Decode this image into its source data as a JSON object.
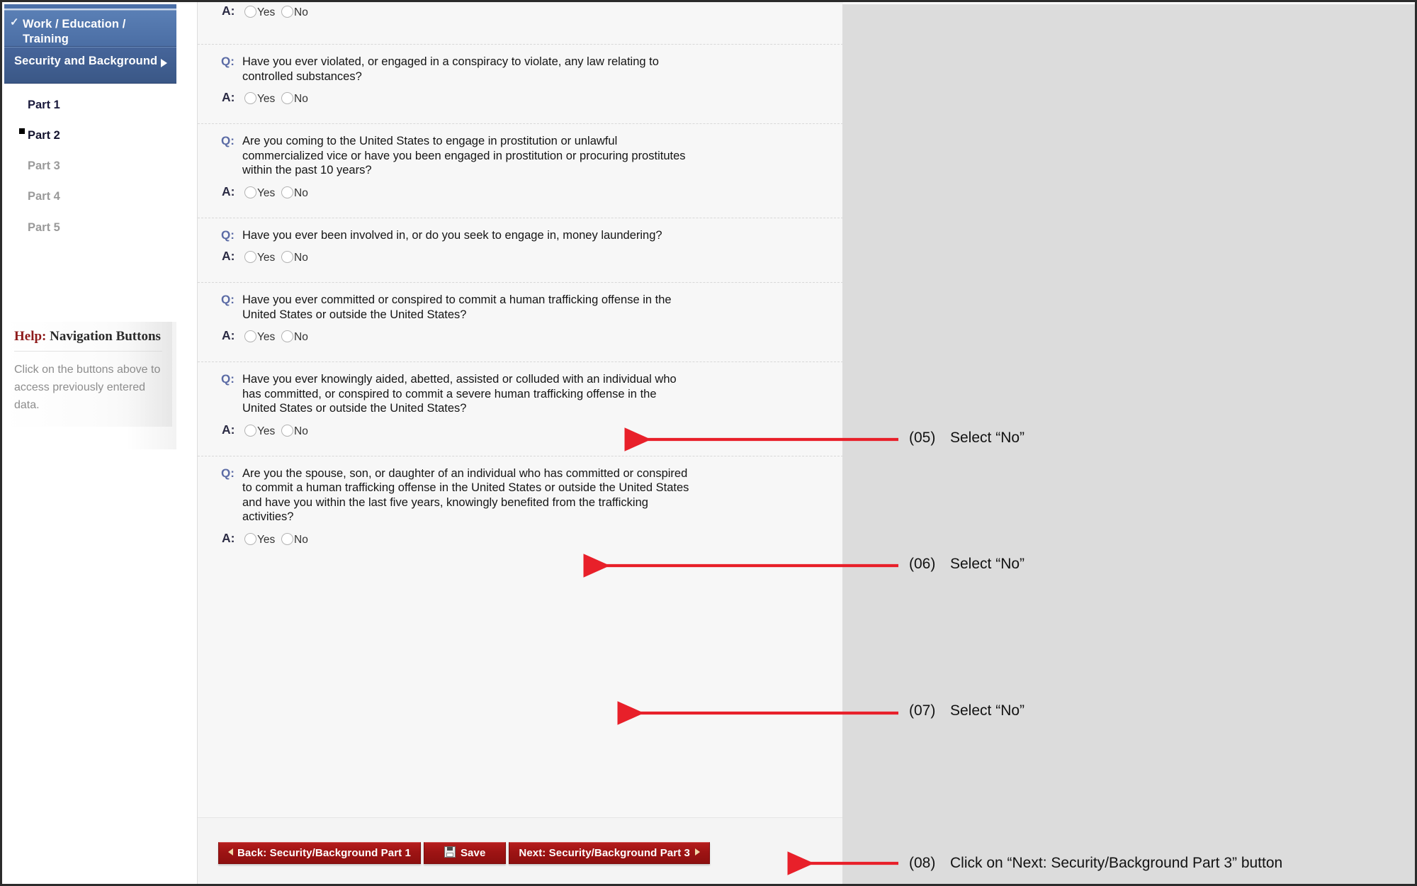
{
  "sidebar": {
    "nav_buttons": [
      {
        "label": "Work / Education / Training",
        "state": "completed",
        "icon": "check-icon"
      },
      {
        "label": "Security and Background",
        "state": "active",
        "icon": "caret-right-icon"
      }
    ],
    "parts": [
      {
        "label": "Part 1",
        "state": "visited"
      },
      {
        "label": "Part 2",
        "state": "current"
      },
      {
        "label": "Part 3",
        "state": "upcoming"
      },
      {
        "label": "Part 4",
        "state": "upcoming"
      },
      {
        "label": "Part 5",
        "state": "upcoming"
      }
    ],
    "help": {
      "title_highlight": "Help:",
      "title_rest": " Navigation Buttons",
      "body": "Click on the buttons above to access previously entered data."
    }
  },
  "form": {
    "q_tag": "Q:",
    "a_tag": "A:",
    "option_yes": "Yes",
    "option_no": "No",
    "questions": [
      {
        "text": "",
        "partial_top": true
      },
      {
        "text": "Have you ever violated, or engaged in a conspiracy to violate, any law relating to controlled substances?"
      },
      {
        "text": "Are you coming to the United States to engage in prostitution or unlawful commercialized vice or have you been engaged in prostitution or procuring prostitutes within the past 10 years?"
      },
      {
        "text": "Have you ever been involved in, or do you seek to engage in, money laundering?"
      },
      {
        "text": "Have you ever committed or conspired to commit a human trafficking offense in the United States or outside the United States?"
      },
      {
        "text": "Have you ever knowingly aided, abetted, assisted or colluded with an individual who has committed, or conspired to commit a severe human trafficking offense in the United States or outside the United States?"
      },
      {
        "text": "Are you the spouse, son, or daughter of an individual who has committed or conspired to commit a human trafficking offense in the United States or outside the United States and have you within the last five years, knowingly benefited from the trafficking activities?"
      }
    ],
    "footer_buttons": [
      {
        "id": "back",
        "label": "Back: Security/Background Part 1",
        "icon": "caret-left-icon"
      },
      {
        "id": "save",
        "label": "Save",
        "icon": "floppy-disk-icon"
      },
      {
        "id": "next",
        "label": "Next: Security/Background Part 3",
        "icon": "caret-right-icon"
      }
    ]
  },
  "annotations": [
    {
      "num": "(05)",
      "text": "Select “No”"
    },
    {
      "num": "(06)",
      "text": "Select “No”"
    },
    {
      "num": "(07)",
      "text": "Select “No”"
    },
    {
      "num": "(08)",
      "text": "Click on “Next: Security/Background Part 3” button"
    }
  ],
  "colors": {
    "arrow_red": "#e8202a",
    "button_red": "#a11515",
    "nav_blue": "#4a6fa8",
    "annotation_bg": "#dcdcdc"
  }
}
